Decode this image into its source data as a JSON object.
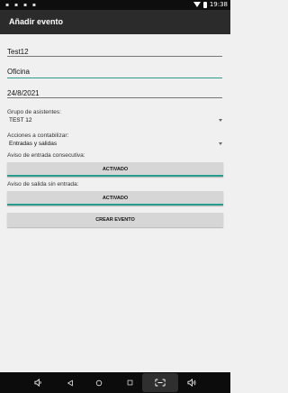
{
  "status_bar": {
    "time": "19:38"
  },
  "app_bar": {
    "title": "Añadir evento"
  },
  "form": {
    "name_value": "Test12",
    "location_value": "Oficina",
    "date_value": "24/8/2021",
    "group_label": "Grupo de asistentes:",
    "group_selected": "TEST 12",
    "actions_label": "Acciones a contabilizar:",
    "actions_selected": "Entradas y salidas",
    "entry_label": "Aviso de entrada consecutiva:",
    "entry_toggle": "ACTIVADO",
    "exit_label": "Aviso de salida sin entrada:",
    "exit_toggle": "ACTIVADO",
    "create_button": "CREAR EVENTO"
  },
  "colors": {
    "accent": "#2a9d8f",
    "app_bar": "#2b2b2b",
    "background": "#f0f0f0"
  },
  "nav_bar": {
    "icons": [
      "volume-down-icon",
      "back-icon",
      "home-icon",
      "recents-icon",
      "screenshot-icon",
      "volume-up-icon"
    ]
  }
}
